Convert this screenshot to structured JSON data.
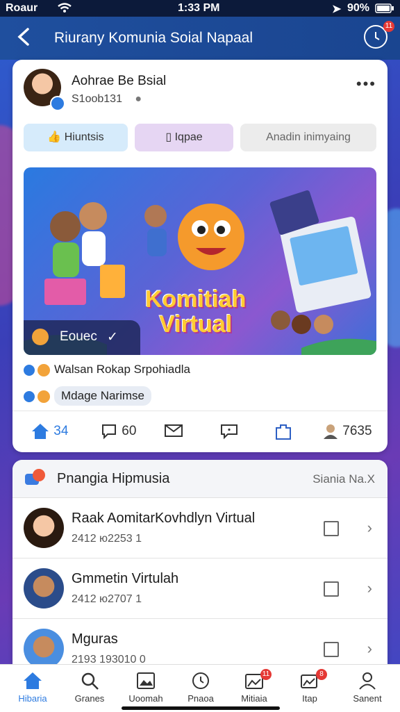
{
  "status_bar": {
    "carrier": "Roaur",
    "time": "1:33 PM",
    "battery": "90%"
  },
  "header": {
    "title": "Riurany Komunia Soial Napaal",
    "badge": "11"
  },
  "post": {
    "author": "Aohrae Be Bsial",
    "meta": "S1oob131",
    "pills": [
      "Hiuntsis",
      "Iqpae",
      "Anadin inimyaing"
    ],
    "banner_title_line1": "Komitiah",
    "banner_title_line2": "Virtual",
    "banner_badge": "Eouec",
    "line1": "Walsan Rokap Srpohiadla",
    "line2": "Mdage Narimse",
    "actions": [
      {
        "icon": "home-icon",
        "label": "34"
      },
      {
        "icon": "comment-icon",
        "label": "60"
      },
      {
        "icon": "mail-icon",
        "label": ""
      },
      {
        "icon": "chat-icon",
        "label": ""
      },
      {
        "icon": "puzzle-icon",
        "label": ""
      },
      {
        "icon": "user-icon",
        "label": "7635"
      }
    ]
  },
  "list": {
    "title": "Pnangia Hipmusia",
    "subtitle": "Siania Na.X",
    "rows": [
      {
        "name": "Raak AomitarKovhdlyn Virtual",
        "sub": "2412 ю2253 1"
      },
      {
        "name": "Gmmetin Virtulah",
        "sub": "2412 ю2707 1"
      },
      {
        "name": "Mguras",
        "sub": "2193 193010 0"
      }
    ]
  },
  "tabs": [
    {
      "label": "Hibaria",
      "active": true
    },
    {
      "label": "Granes"
    },
    {
      "label": "Uoomah"
    },
    {
      "label": "Pnaoa"
    },
    {
      "label": "Mitiaia",
      "badge": "11"
    },
    {
      "label": "Itap",
      "badge": "8"
    },
    {
      "label": "Sanent"
    }
  ],
  "colors": {
    "accent": "#2d7be0",
    "header": "#1f4f9e",
    "badge": "#e53935"
  }
}
